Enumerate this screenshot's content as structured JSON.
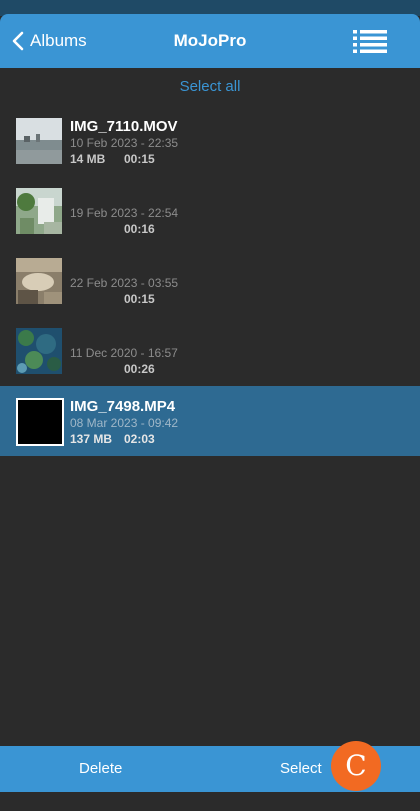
{
  "header": {
    "back_label": "Albums",
    "title": "MoJoPro",
    "menu_icon": "list-icon"
  },
  "select_all": "Select all",
  "items": [
    {
      "name": "IMG_7110.MOV",
      "date": "10 Feb 2023 - 22:35",
      "size": "14 MB",
      "duration": "00:15",
      "selected": false
    },
    {
      "name": "",
      "date": "19 Feb 2023 - 22:54",
      "size": "",
      "duration": "00:16",
      "selected": false
    },
    {
      "name": "",
      "date": "22 Feb 2023 - 03:55",
      "size": "",
      "duration": "00:15",
      "selected": false
    },
    {
      "name": "",
      "date": "11 Dec 2020 - 16:57",
      "size": "",
      "duration": "00:26",
      "selected": false
    },
    {
      "name": "IMG_7498.MP4",
      "date": "08 Mar 2023 - 09:42",
      "size": "137 MB",
      "duration": "02:03",
      "selected": true
    }
  ],
  "footer": {
    "delete_label": "Delete",
    "select_label": "Select",
    "fab_label": "C"
  },
  "colors": {
    "accent": "#3a95d4",
    "selected_row": "#2e6a92",
    "background": "#2b2b2b",
    "fab": "#f26a22"
  }
}
